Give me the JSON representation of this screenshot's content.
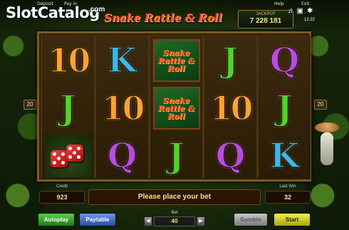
{
  "watermark": {
    "name": "SlotCatalog",
    "suffix": ".com"
  },
  "top_links": {
    "deposit": "Deposit",
    "payin": "Pay in",
    "help": "Help",
    "exit": "Exit"
  },
  "game": {
    "title": "Snake Rattle & Roll"
  },
  "jackpot": {
    "label": "JACKPOT",
    "value": "7 228 181"
  },
  "system": {
    "clock": "12:22",
    "sound_icon": "speaker-icon",
    "fullscreen_icon": "expand-icon",
    "settings_icon": "gear-icon"
  },
  "paylines": {
    "left": "20",
    "right": "20"
  },
  "reels": [
    [
      "10",
      "J",
      "dice"
    ],
    [
      "K",
      "10",
      "Q"
    ],
    [
      "scatter",
      "scatter",
      "J"
    ],
    [
      "J",
      "10",
      "Q"
    ],
    [
      "Q",
      "J",
      "K"
    ]
  ],
  "scatter_text": "Snake Rattle & Roll",
  "panel": {
    "credit_label": "Credit",
    "credit_value": "923",
    "message": "Please place your bet",
    "last_win_label": "Last Win",
    "last_win_value": "32",
    "bet_label": "Bet",
    "bet_value": "40"
  },
  "buttons": {
    "autoplay": "Autoplay",
    "paytable": "Paytable",
    "gamble": "Gamble",
    "start": "Start"
  },
  "colors": {
    "ten": "#ffa42a",
    "jack": "#4fd52a",
    "king": "#3ab8e8",
    "queen": "#b84ae8",
    "start": "#f6f24a",
    "accent": "#ffe07a"
  }
}
